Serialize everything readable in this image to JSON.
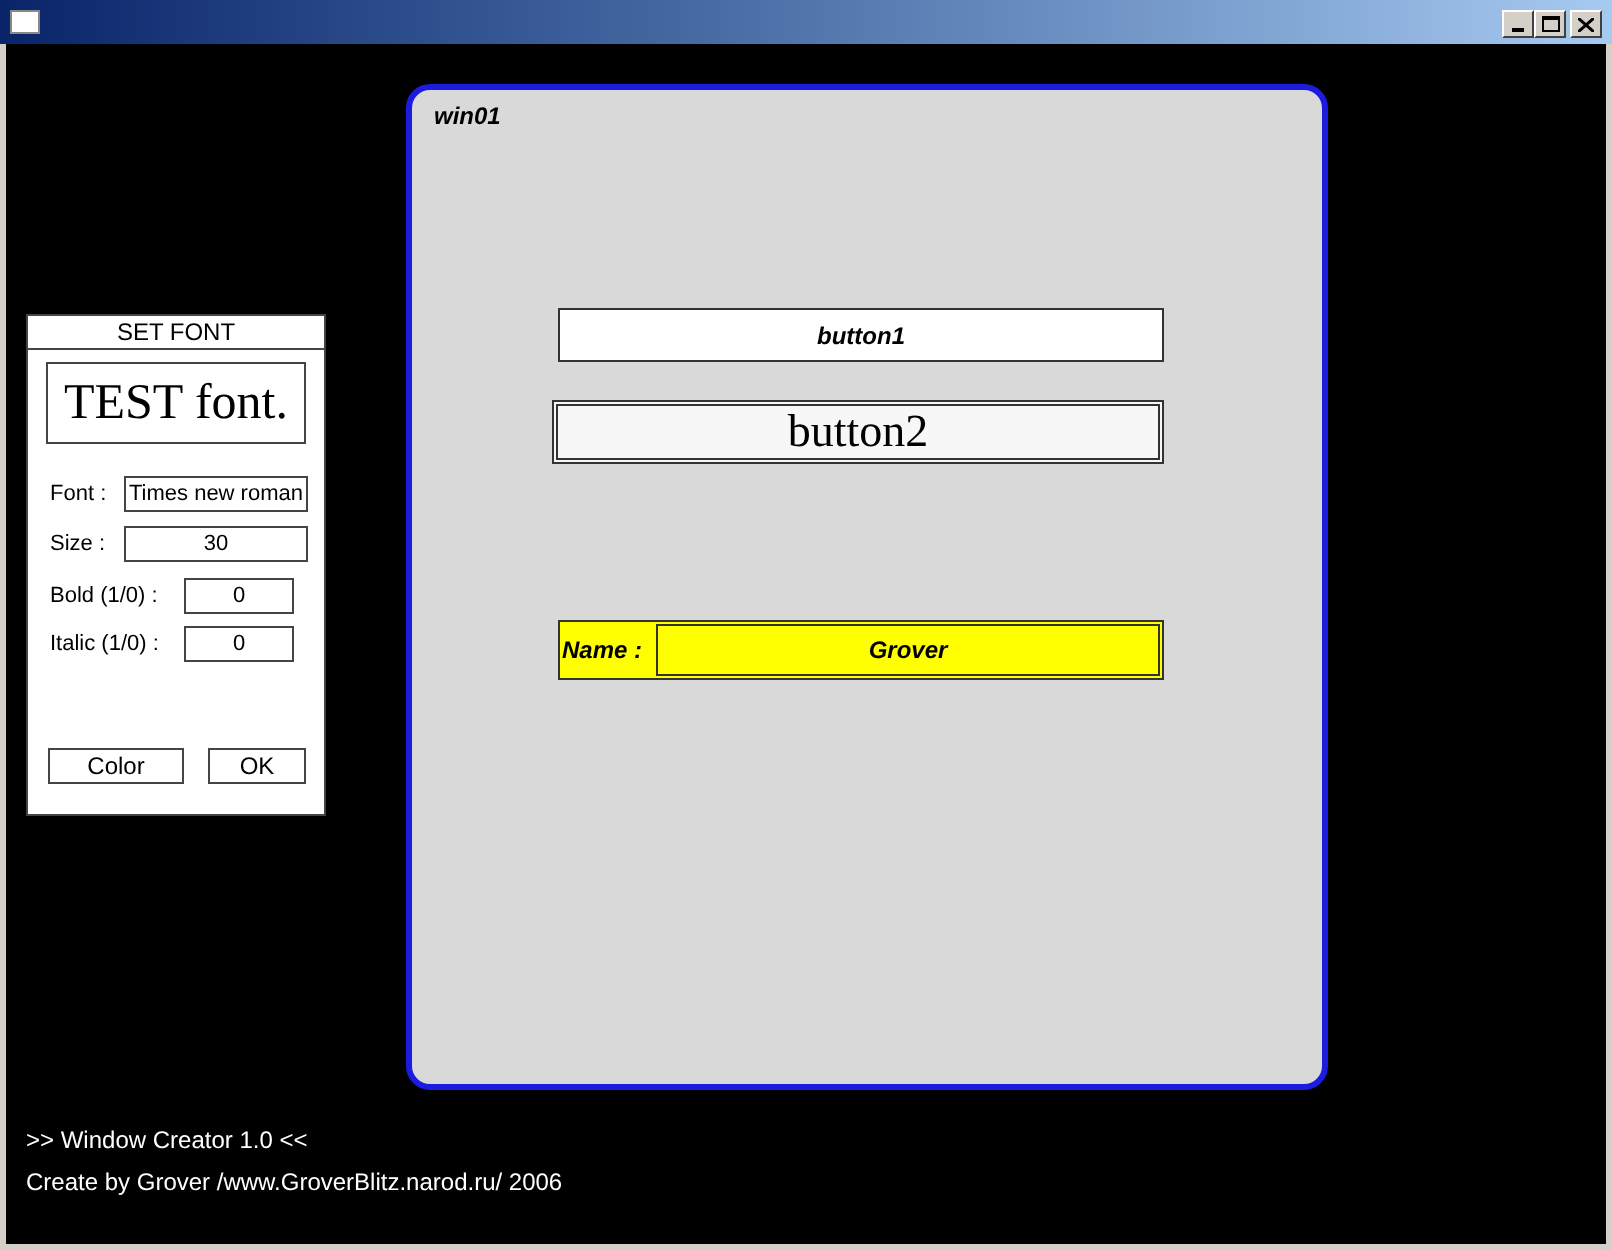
{
  "set_font_panel": {
    "title": "SET FONT",
    "preview": "TEST font.",
    "fields": [
      {
        "label": "Font :",
        "value": "Times new roman",
        "kind": "wide"
      },
      {
        "label": "Size :",
        "value": "30",
        "kind": "wide"
      },
      {
        "label": "Bold (1/0) :",
        "value": "0",
        "kind": "narrow"
      },
      {
        "label": "Italic (1/0) :",
        "value": "0",
        "kind": "narrow"
      }
    ],
    "buttons": [
      "Color",
      "OK"
    ]
  },
  "window": {
    "title": "win01",
    "widgets": [
      {
        "kind": "button",
        "label": "button1",
        "framed": false
      },
      {
        "kind": "button",
        "label": "button2",
        "framed": true
      },
      {
        "kind": "field",
        "label": "Name :",
        "value": "Grover"
      }
    ]
  },
  "footer": [
    ">> Window Creator 1.0 <<",
    "Create by Grover /www.GroverBlitz.narod.ru/ 2006"
  ]
}
